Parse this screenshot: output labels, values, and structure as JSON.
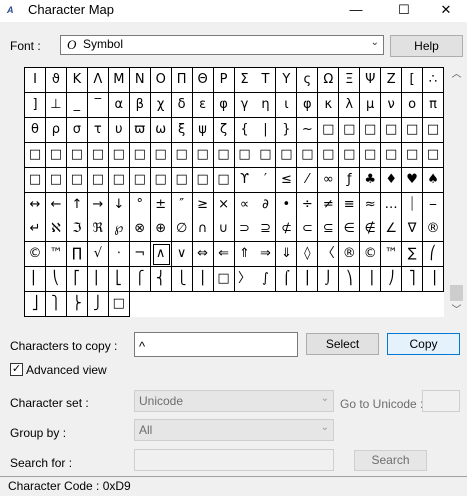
{
  "window": {
    "title": "Character Map",
    "icon": "charmap-app-icon"
  },
  "controls": {
    "minimize": "—",
    "maximize": "☐",
    "close": "✕"
  },
  "font": {
    "label": "Font :",
    "value": "Symbol",
    "help_label": "Help"
  },
  "grid": {
    "rows": [
      [
        "I",
        "ϑ",
        "K",
        "Λ",
        "M",
        "N",
        "O",
        "Π",
        "Θ",
        "P",
        "Σ",
        "T",
        "Y",
        "ς",
        "Ω",
        "Ξ",
        "Ψ",
        "Z",
        "[",
        "∴"
      ],
      [
        "]",
        "⊥",
        "_",
        "‾",
        "α",
        "β",
        "χ",
        "δ",
        "ε",
        "φ",
        "γ",
        "η",
        "ι",
        "φ",
        "κ",
        "λ",
        "μ",
        "ν",
        "ο",
        "π"
      ],
      [
        "θ",
        "ρ",
        "σ",
        "τ",
        "υ",
        "ϖ",
        "ω",
        "ξ",
        "ψ",
        "ζ",
        "{",
        "|",
        "}",
        "~",
        "□",
        "□",
        "□",
        "□",
        "□",
        "□"
      ],
      [
        "□",
        "□",
        "□",
        "□",
        "□",
        "□",
        "□",
        "□",
        "□",
        "□",
        "□",
        "□",
        "□",
        "□",
        "□",
        "□",
        "□",
        "□",
        "□",
        "□"
      ],
      [
        "□",
        "□",
        "□",
        "□",
        "□",
        "□",
        "□",
        "□",
        "□",
        "□",
        "ϒ",
        "′",
        "≤",
        "⁄",
        "∞",
        "ƒ",
        "♣",
        "♦",
        "♥",
        "♠"
      ],
      [
        "↔",
        "←",
        "↑",
        "→",
        "↓",
        "°",
        "±",
        "″",
        "≥",
        "×",
        "∝",
        "∂",
        "•",
        "÷",
        "≠",
        "≡",
        "≈",
        "…",
        "⏐",
        "⎯"
      ],
      [
        "↵",
        "ℵ",
        "ℑ",
        "ℜ",
        "℘",
        "⊗",
        "⊕",
        "∅",
        "∩",
        "∪",
        "⊃",
        "⊇",
        "⊄",
        "⊂",
        "⊆",
        "∈",
        "∉",
        "∠",
        "∇",
        "®"
      ],
      [
        "©",
        "™",
        "∏",
        "√",
        "⋅",
        "¬",
        "∧",
        "∨",
        "⇔",
        "⇐",
        "⇑",
        "⇒",
        "⇓",
        "◊",
        "〈",
        "®",
        "©",
        "™",
        "∑",
        "⎛"
      ],
      [
        "⎜",
        "⎝",
        "⎡",
        "⎢",
        "⎣",
        "⎧",
        "⎨",
        "⎩",
        "⎪",
        "□",
        "〉",
        "∫",
        "⌠",
        "⎮",
        "⌡",
        "⎞",
        "⎟",
        "⎠",
        "⎤",
        "⎥"
      ],
      [
        "⎦",
        "⎫",
        "⎬",
        "⎭",
        "□"
      ]
    ],
    "selected_row": 7,
    "selected_col": 6
  },
  "copy": {
    "label": "Characters to copy :",
    "value": "^",
    "select_label": "Select",
    "copy_label": "Copy"
  },
  "advanced": {
    "label": "Advanced view",
    "checked": "✓"
  },
  "charset": {
    "label": "Character set :",
    "value": "Unicode",
    "goto_label": "Go to Unicode :"
  },
  "groupby": {
    "label": "Group by :",
    "value": "All"
  },
  "search": {
    "label": "Search for :",
    "button_label": "Search"
  },
  "status": {
    "text": "Character Code : 0xD9"
  }
}
